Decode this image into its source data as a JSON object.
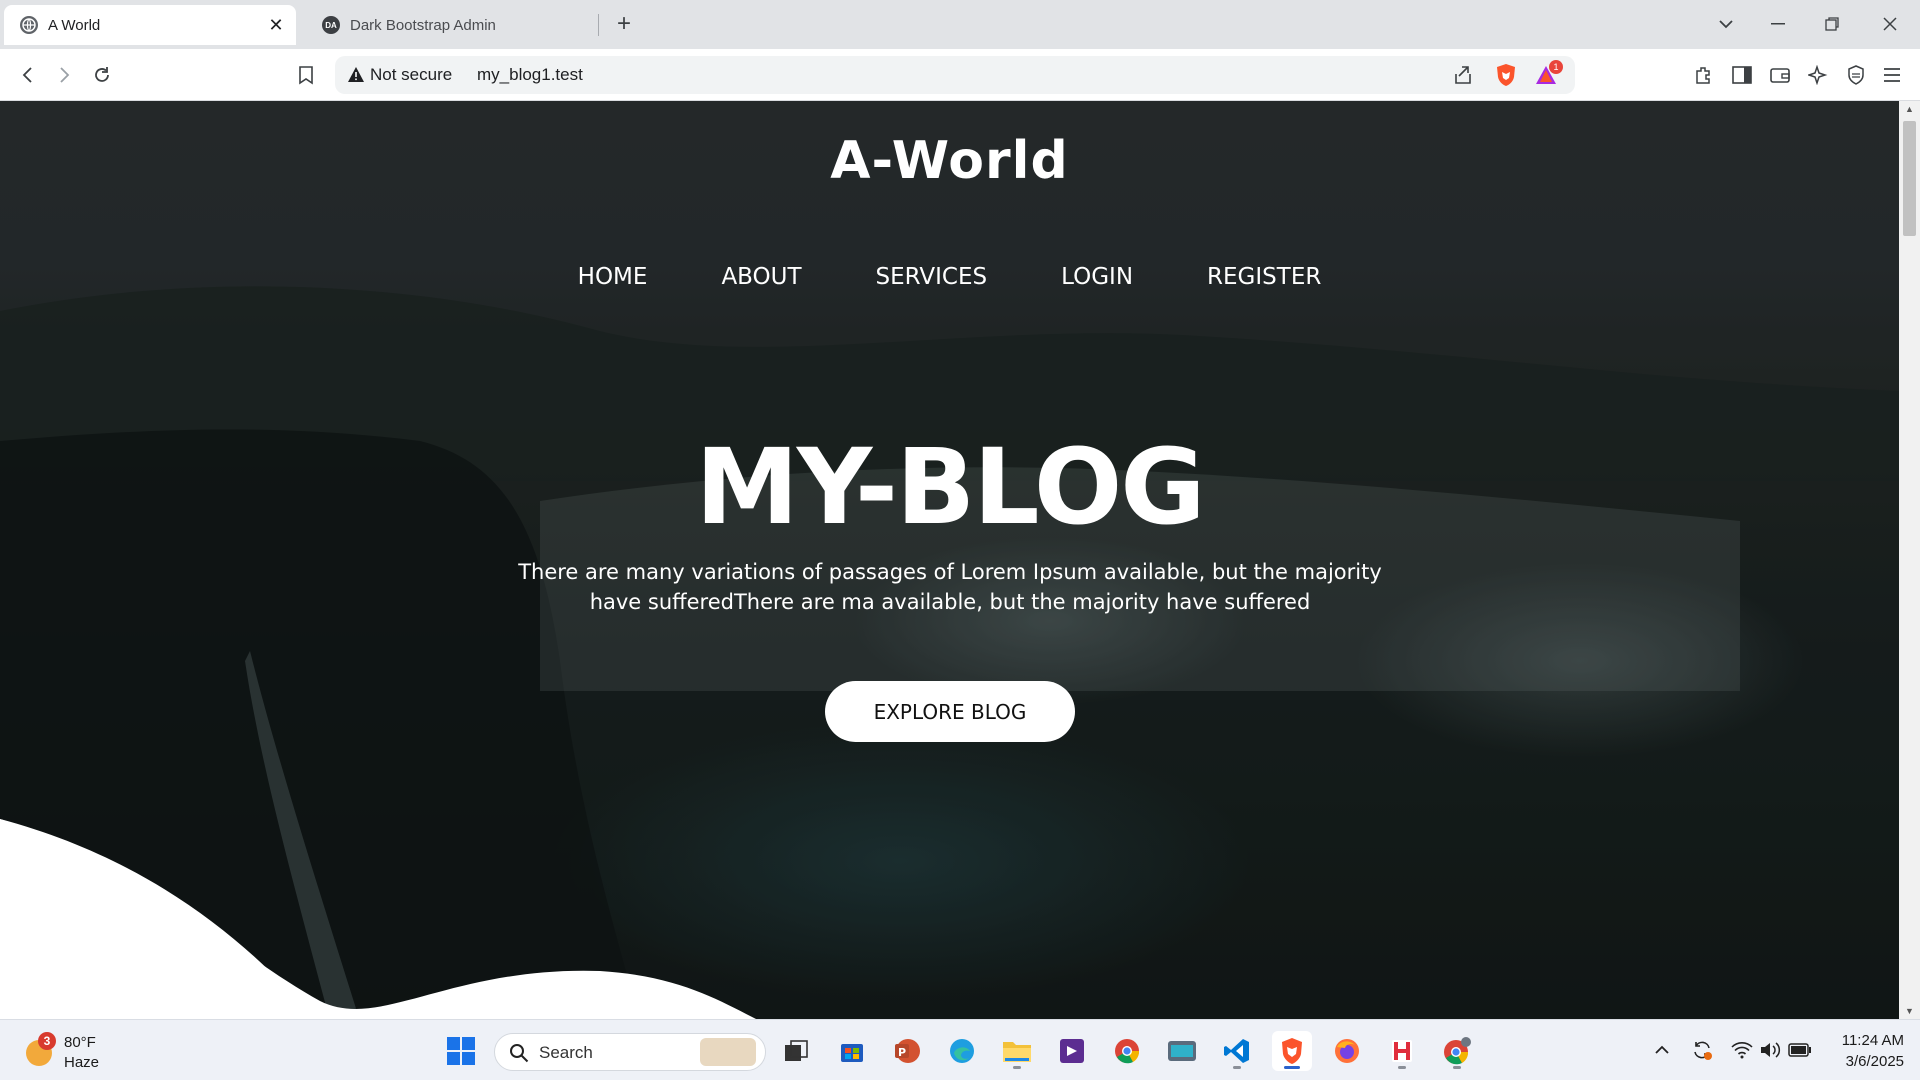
{
  "browser": {
    "tabs": [
      {
        "title": "A World",
        "favicon": "globe-icon",
        "active": true
      },
      {
        "title": "Dark Bootstrap Admin",
        "favicon_text": "DA",
        "active": false
      }
    ],
    "address": {
      "security_label": "Not secure",
      "url": "my_blog1.test"
    },
    "shields_badge": "1"
  },
  "page": {
    "brand": "A-World",
    "nav": [
      "HOME",
      "ABOUT",
      "SERVICES",
      "LOGIN",
      "REGISTER"
    ],
    "hero_title": "MY-BLOG",
    "hero_text": "There are many variations of passages of Lorem Ipsum available, but the majority have sufferedThere are ma available, but the majority have suffered",
    "cta": "EXPLORE BLOG"
  },
  "taskbar": {
    "weather": {
      "badge": "3",
      "temp": "80°F",
      "condition": "Haze"
    },
    "search_placeholder": "Search",
    "clock": {
      "time": "11:24 AM",
      "date": "3/6/2025"
    }
  },
  "colors": {
    "accent": "#2b62cc",
    "brave_orange": "#fb542b"
  }
}
